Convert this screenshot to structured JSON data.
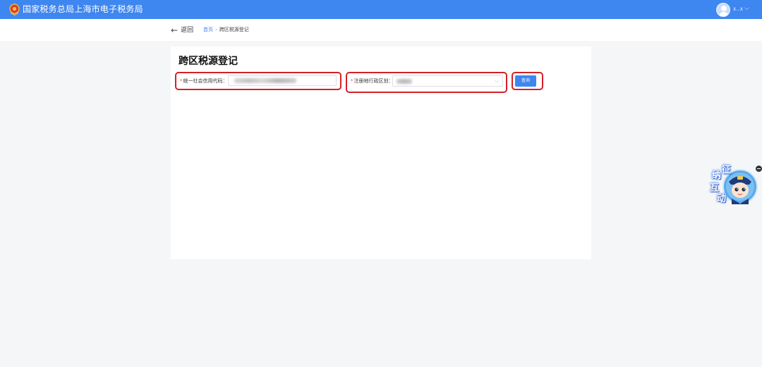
{
  "header": {
    "site_title": "国家税务总局上海市电子税务局",
    "user_name": "X...X",
    "user_chevron": "⌵"
  },
  "subnav": {
    "back_label": "返回",
    "breadcrumb": {
      "home": "首页",
      "separator": "›",
      "current": "跨区税源登记"
    }
  },
  "form": {
    "title": "跨区税源登记",
    "required_mark": "*",
    "credit_code_label": "统一社会信用代码：",
    "credit_code_value": "",
    "region_label": "注册地行政区划：",
    "region_value": "",
    "query_button": "查询"
  },
  "helper_widget": {
    "text_chars": [
      "征",
      "纳",
      "互",
      "动"
    ]
  },
  "colors": {
    "brand_blue": "#3e86f0",
    "highlight_red": "#d32127",
    "background": "#f5f6f8"
  }
}
